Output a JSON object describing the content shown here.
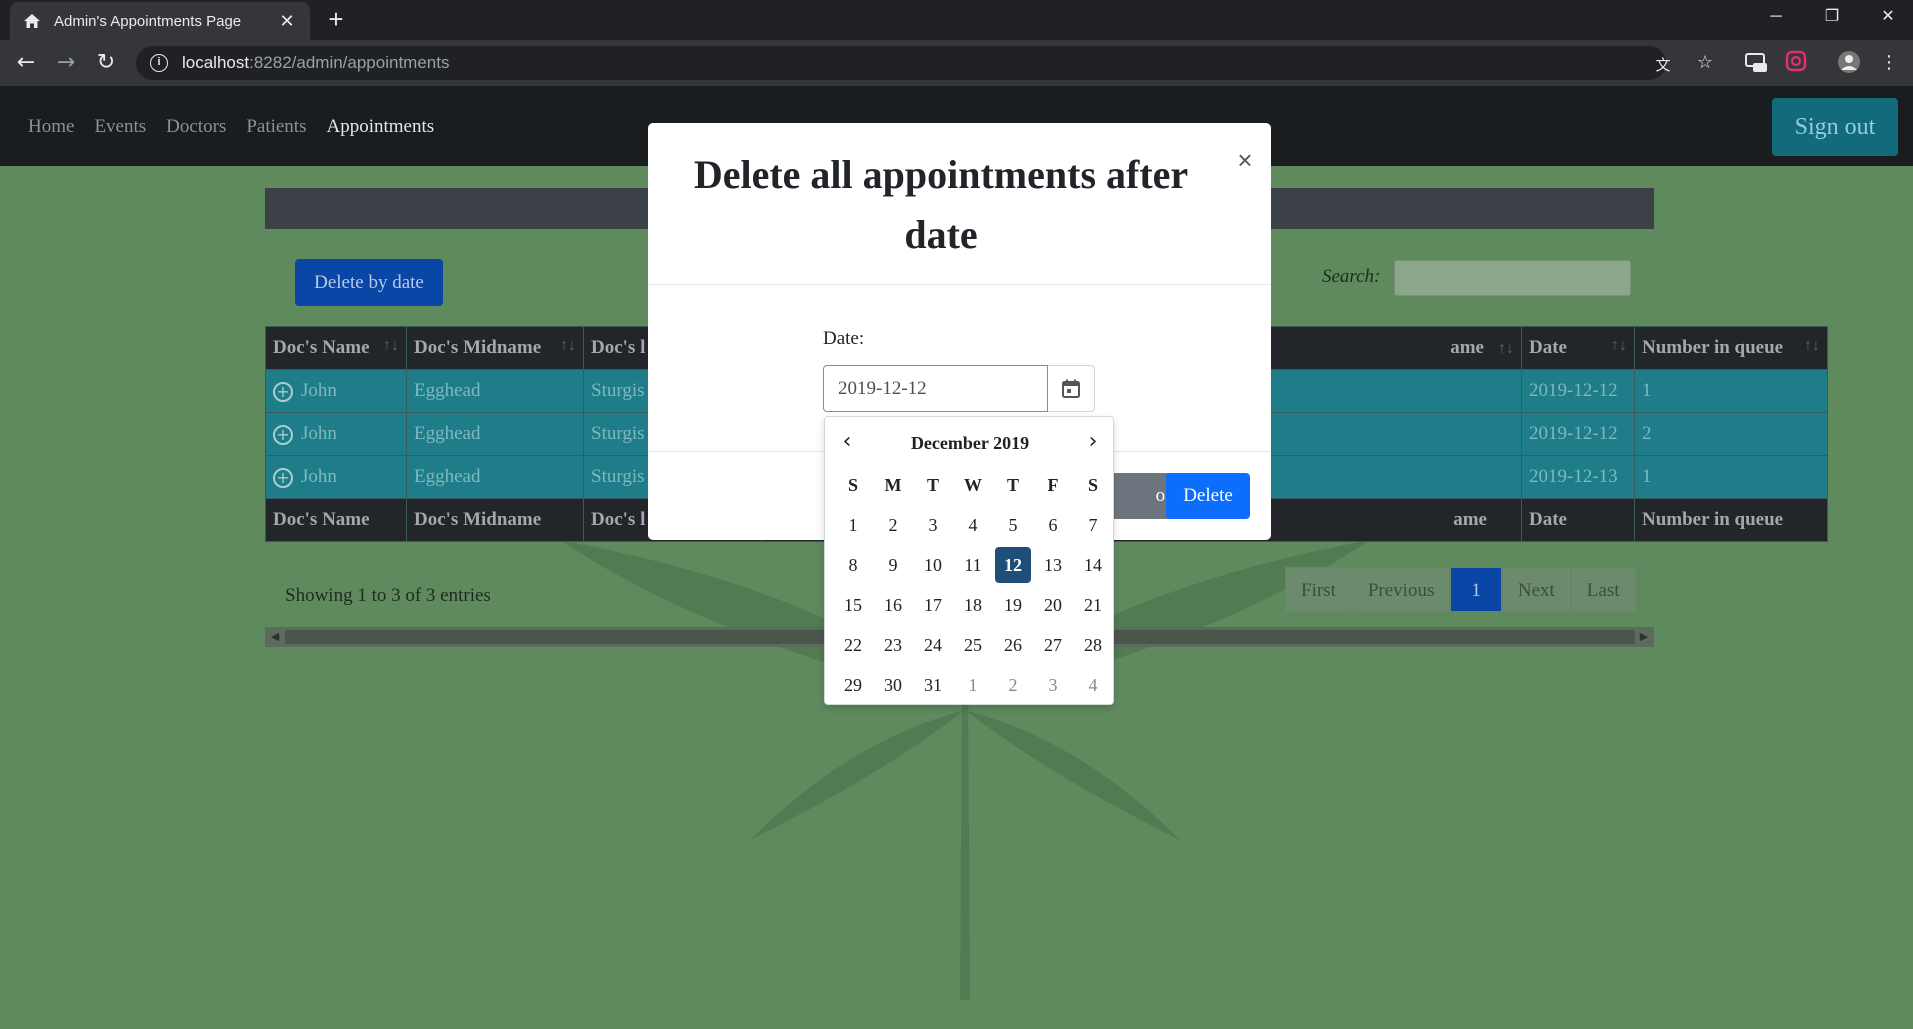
{
  "browser": {
    "tab_title": "Admin's Appointments Page",
    "url_host": "localhost",
    "url_path": ":8282/admin/appointments"
  },
  "nav": {
    "links": [
      "Home",
      "Events",
      "Doctors",
      "Patients",
      "Appointments"
    ],
    "active": "Appointments",
    "sign_out": "Sign out"
  },
  "toolbar": {
    "delete_by_date": "Delete by date",
    "search_label": "Search:"
  },
  "table": {
    "headers": [
      "Doc's Name",
      "Doc's Midname",
      "Doc's l",
      "ame",
      "Date",
      "Number in queue"
    ],
    "rows": [
      [
        "John",
        "Egghead",
        "Sturgis",
        "",
        "2019-12-12",
        "1"
      ],
      [
        "John",
        "Egghead",
        "Sturgis",
        "",
        "2019-12-12",
        "2"
      ],
      [
        "John",
        "Egghead",
        "Sturgis",
        "",
        "2019-12-13",
        "1"
      ]
    ]
  },
  "footer": {
    "entries": "Showing 1 to 3 of 3 entries",
    "pager": {
      "first": "First",
      "previous": "Previous",
      "current": "1",
      "next": "Next",
      "last": "Last"
    }
  },
  "modal": {
    "title_line1": "Delete all appointments after",
    "title_line2": "date",
    "close_symbol": "×",
    "date_label": "Date:",
    "date_value": "2019-12-12",
    "close_button": "ose",
    "delete_button": "Delete"
  },
  "datepicker": {
    "month": "December 2019",
    "weekdays": [
      "S",
      "M",
      "T",
      "W",
      "T",
      "F",
      "S"
    ],
    "days": [
      "1",
      "2",
      "3",
      "4",
      "5",
      "6",
      "7",
      "8",
      "9",
      "10",
      "11",
      "12",
      "13",
      "14",
      "15",
      "16",
      "17",
      "18",
      "19",
      "20",
      "21",
      "22",
      "23",
      "24",
      "25",
      "26",
      "27",
      "28",
      "29",
      "30",
      "31",
      "1",
      "2",
      "3",
      "4"
    ],
    "selected": "12",
    "next_month_from_index": 31
  },
  "colors": {
    "page_bg": "#5e8a5e",
    "primary": "#0d6efd",
    "selected_day": "#1f4e79",
    "signout": "#136a7a"
  }
}
